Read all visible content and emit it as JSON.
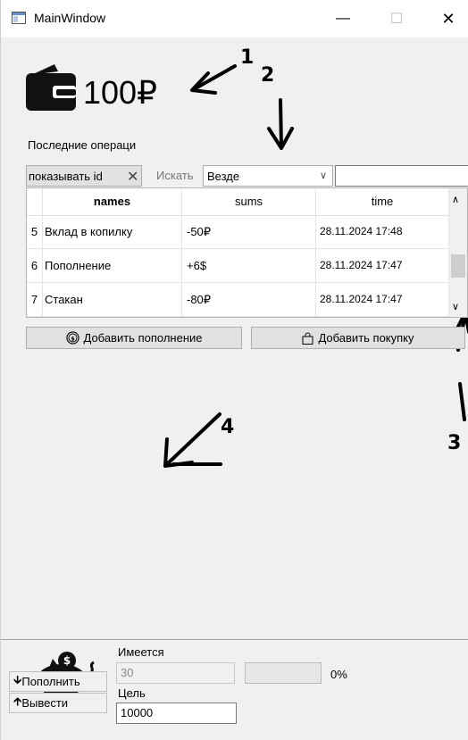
{
  "window": {
    "title": "MainWindow",
    "minimize": "—",
    "maximize": "☐",
    "close": "✕"
  },
  "balance": {
    "amount": "100₽"
  },
  "annotations": [
    "1",
    "2",
    "3",
    "4"
  ],
  "recent": {
    "label": "Последние операци"
  },
  "filter": {
    "chip_label": "показывать id",
    "chip_close": "✕",
    "search_label": "Искать",
    "scope_value": "Везде",
    "search_value": "",
    "clear": "✕"
  },
  "table": {
    "headers": {
      "id": "",
      "names": "names",
      "sums": "sums",
      "time": "time"
    },
    "rows": [
      {
        "id": "5",
        "name": "Вклад в копилку",
        "sum": "-50₽",
        "time": "28.11.2024 17:48"
      },
      {
        "id": "6",
        "name": "Пополнение",
        "sum": "+6$",
        "time": "28.11.2024 17:47"
      },
      {
        "id": "7",
        "name": "Стакан",
        "sum": "-80₽",
        "time": "28.11.2024 17:47"
      }
    ],
    "scroll": {
      "position_fraction": 0.55
    }
  },
  "actions": {
    "add_income": "Добавить пополнение",
    "add_purchase": "Добавить покупку"
  },
  "piggy": {
    "has_label": "Имеется",
    "has_value": "30",
    "progress_percent": 0,
    "progress_text": "0%",
    "goal_label": "Цель",
    "goal_value": "10000",
    "topup_label": "Пополнить",
    "withdraw_label": "Вывести"
  }
}
